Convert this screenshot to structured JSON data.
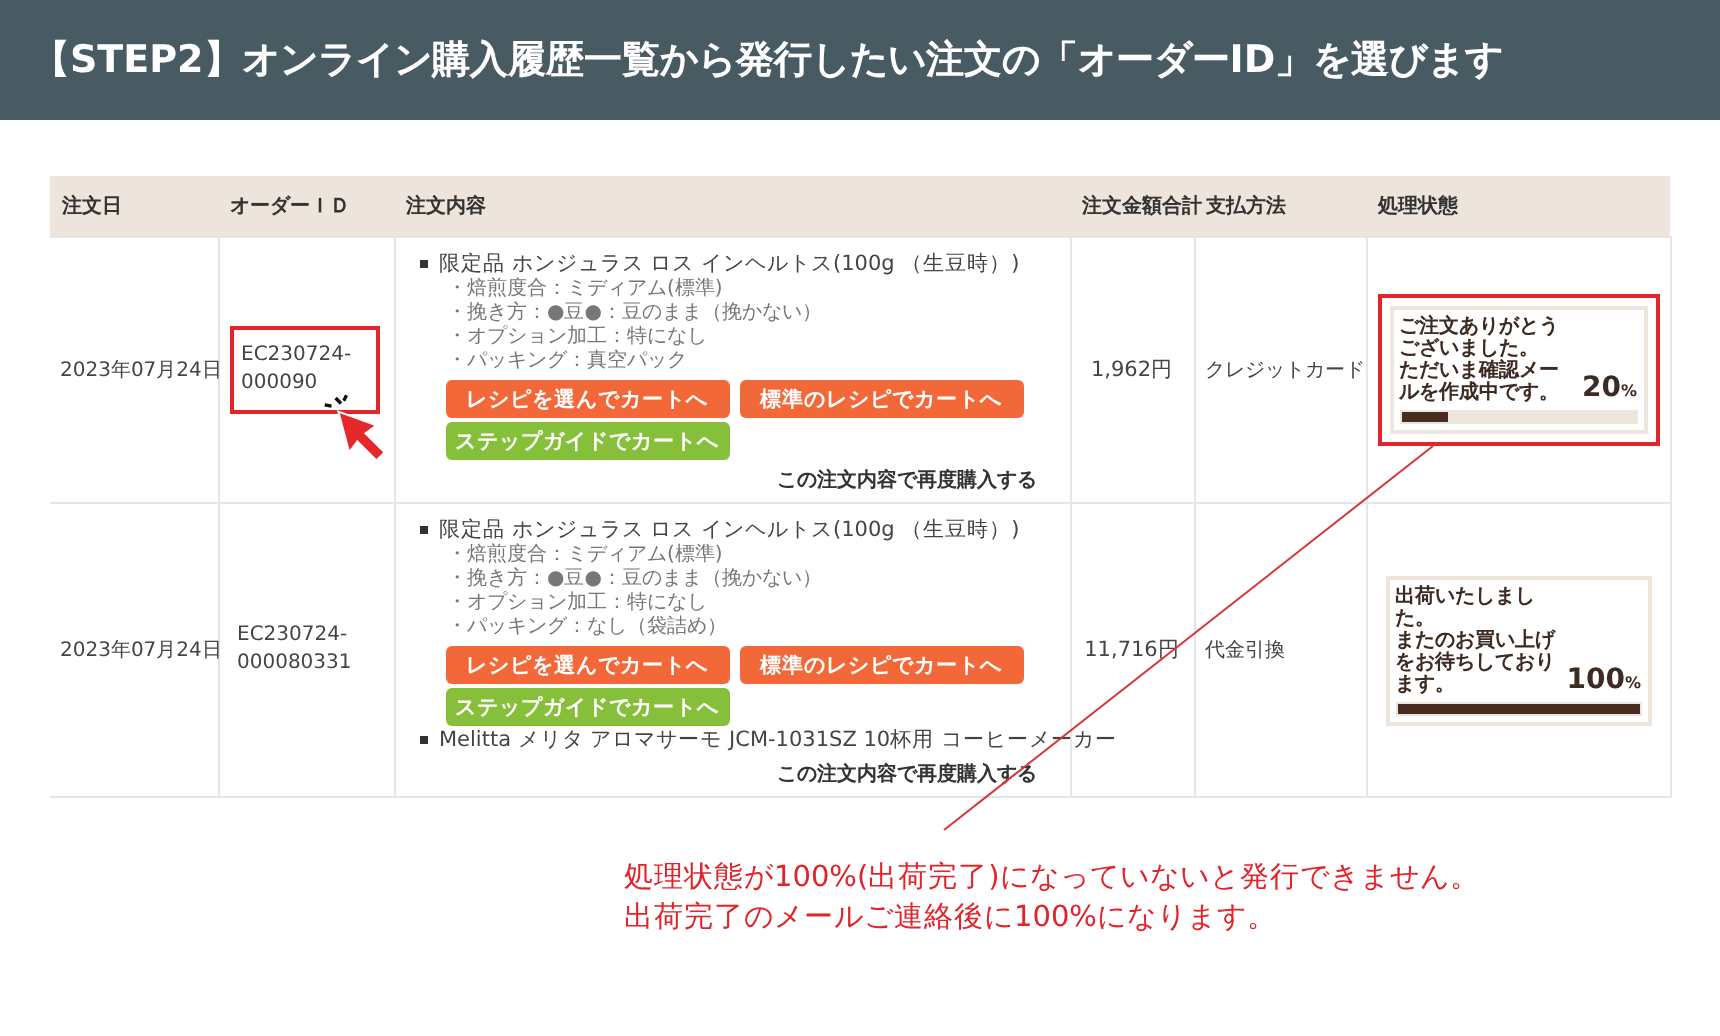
{
  "banner": {
    "title": "【STEP2】オンライン購入履歴一覧から発行したい注文の「オーダーID」を選びます"
  },
  "table": {
    "columns": [
      "注文日",
      "オーダーＩＤ",
      "注文内容",
      "注文金額合計",
      "支払方法",
      "処理状態"
    ],
    "rows": [
      {
        "date": "2023年07月24日",
        "order_id": {
          "text": "EC230724-000090",
          "highlighted": true
        },
        "items": [
          {
            "name": "限定品 ホンジュラス ロス インヘルトス(100g （生豆時）)",
            "options": [
              "・焙煎度合：ミディアム(標準)",
              "・挽き方：●豆●：豆のまま（挽かない）",
              "・オプション加工：特になし",
              "・パッキング：真空パック"
            ],
            "buttons": [
              {
                "label": "レシピを選んでカートへ",
                "kind": "orange"
              },
              {
                "label": "標準のレシピでカートへ",
                "kind": "orange"
              },
              {
                "label": "ステップガイドでカートへ",
                "kind": "green"
              }
            ]
          }
        ],
        "repurchase": "この注文内容で再度購入する",
        "total": "1,962円",
        "payment": "クレジットカード",
        "status": {
          "lines": [
            "ご注文ありがとうございました。",
            "ただいま確認メールを作成中です。"
          ],
          "percent": "20",
          "unit": "%",
          "level": 0.2,
          "highlighted": true
        }
      },
      {
        "date": "2023年07月24日",
        "order_id": {
          "text": "EC230724-000080331",
          "highlighted": false
        },
        "items": [
          {
            "name": "限定品 ホンジュラス ロス インヘルトス(100g （生豆時）)",
            "options": [
              "・焙煎度合：ミディアム(標準)",
              "・挽き方：●豆●：豆のまま（挽かない）",
              "・オプション加工：特になし",
              "・パッキング：なし（袋詰め）"
            ],
            "buttons": [
              {
                "label": "レシピを選んでカートへ",
                "kind": "orange"
              },
              {
                "label": "標準のレシピでカートへ",
                "kind": "orange"
              },
              {
                "label": "ステップガイドでカートへ",
                "kind": "green"
              }
            ]
          },
          {
            "name": "Melitta メリタ アロマサーモ JCM-1031SZ 10杯用 コーヒーメーカー"
          }
        ],
        "repurchase": "この注文内容で再度購入する",
        "total": "11,716円",
        "payment": "代金引換",
        "status": {
          "lines": [
            "出荷いたしました。",
            "またのお買い上げをお待ちしております。"
          ],
          "percent": "100",
          "unit": "%",
          "level": 1,
          "highlighted": false
        }
      }
    ]
  },
  "callout": {
    "lines": [
      "処理状態が100%(出荷完了)になっていないと発行できません。",
      "出荷完了のメールご連絡後に100%になります。"
    ]
  }
}
